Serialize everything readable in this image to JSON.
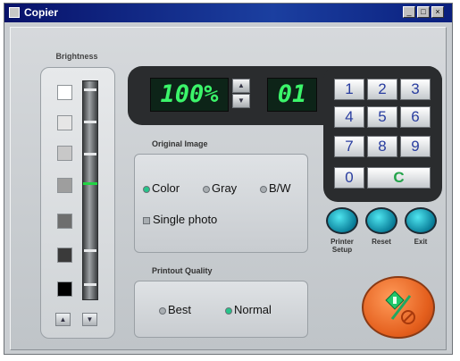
{
  "window": {
    "title": "Copier",
    "controls": [
      "_",
      "□",
      "×"
    ]
  },
  "brightness": {
    "label": "Brightness",
    "swatches": [
      "#ffffff",
      "#e6e6e6",
      "#c8c8c8",
      "#9e9e9e",
      "#6e6e6e",
      "#3a3a3a",
      "#000000"
    ],
    "level_fraction_from_top": 0.47,
    "up_icon": "triangle-up",
    "down_icon": "triangle-down"
  },
  "display": {
    "zoom": "100%",
    "copies": "01"
  },
  "keypad": {
    "keys": [
      "1",
      "2",
      "3",
      "4",
      "5",
      "6",
      "7",
      "8",
      "9",
      "0",
      "C"
    ]
  },
  "original_image": {
    "label": "Original Image",
    "options": [
      "Color",
      "Gray",
      "B/W"
    ],
    "selected": "Color",
    "single_photo": "Single photo"
  },
  "printout_quality": {
    "label": "Printout Quality",
    "options": [
      "Best",
      "Normal"
    ],
    "selected": "Normal"
  },
  "actions": {
    "printer_setup": "Printer Setup",
    "reset": "Reset",
    "exit": "Exit"
  },
  "colors": {
    "lcd_text": "#3bf56a",
    "selected_radio": "#26c48a",
    "start_button": "#e45f1d",
    "round_buttons": "#0a8fb0"
  }
}
